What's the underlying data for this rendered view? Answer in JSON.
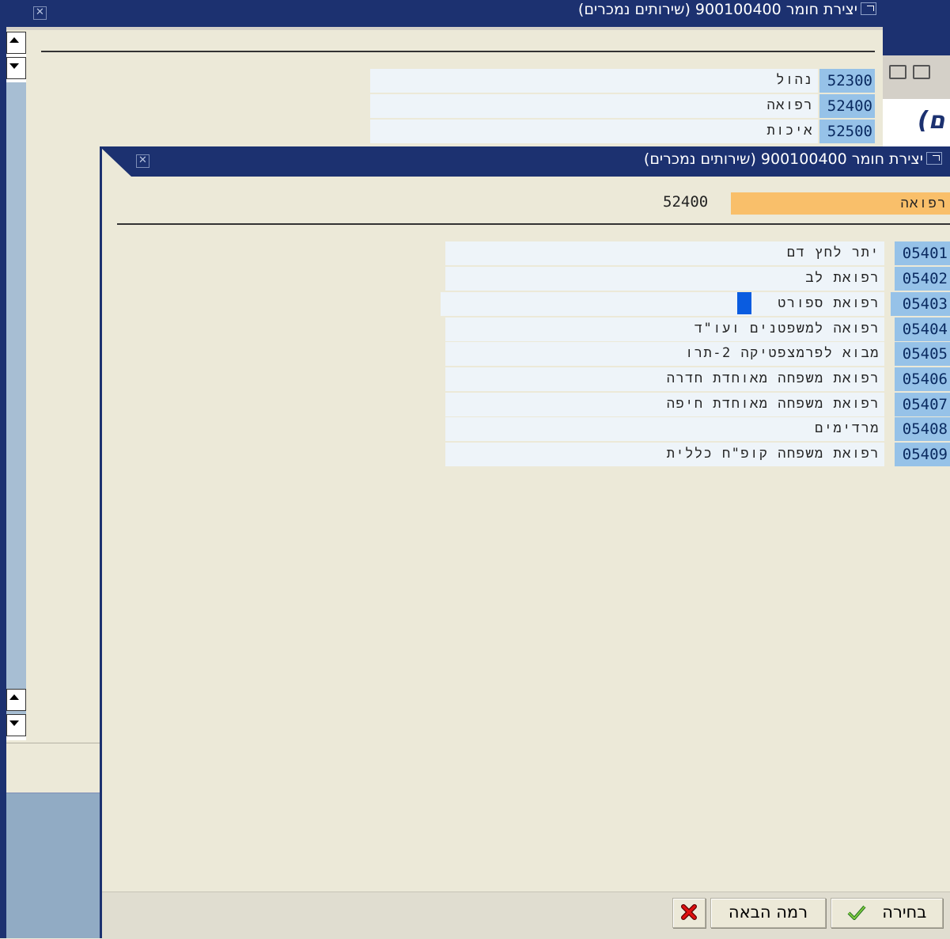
{
  "background_window": {
    "title": "יצירת חומר 900100400 (שירותים נמכרים)",
    "rows": [
      {
        "code": "52300",
        "label": "נהול"
      },
      {
        "code": "52400",
        "label": "רפואה"
      },
      {
        "code": "52500",
        "label": "איכות"
      }
    ],
    "partial_heading": "(ם"
  },
  "dialog": {
    "title": "יצירת חומר 900100400 (שירותים נמכרים)",
    "selected_code": "52400",
    "selected_label": "רפואה",
    "items": [
      {
        "code": "05401",
        "label": "יתר לחץ דם"
      },
      {
        "code": "05402",
        "label": "רפואת לב"
      },
      {
        "code": "05403",
        "label": "רפואת ספורט"
      },
      {
        "code": "05404",
        "label": "רפואה למשפטנים ועו\"ד"
      },
      {
        "code": "05405",
        "label": "מבוא לפרמצפטיקה 2-תרו"
      },
      {
        "code": "05406",
        "label": "רפואת משפחה מאוחדת חדרה"
      },
      {
        "code": "05407",
        "label": "רפואת משפחה מאוחדת חיפה"
      },
      {
        "code": "05408",
        "label": "מרדימים"
      },
      {
        "code": "05409",
        "label": "רפואת משפחה קופ\"ח כללית"
      }
    ],
    "buttons": {
      "choose": "בחירה",
      "next_level": "רמה הבאה"
    }
  },
  "colors": {
    "titlebar": "#1c3170",
    "code_highlight": "#96c2e8",
    "selected_header": "#f9bf6a",
    "cursor": "#0a5ce0"
  }
}
